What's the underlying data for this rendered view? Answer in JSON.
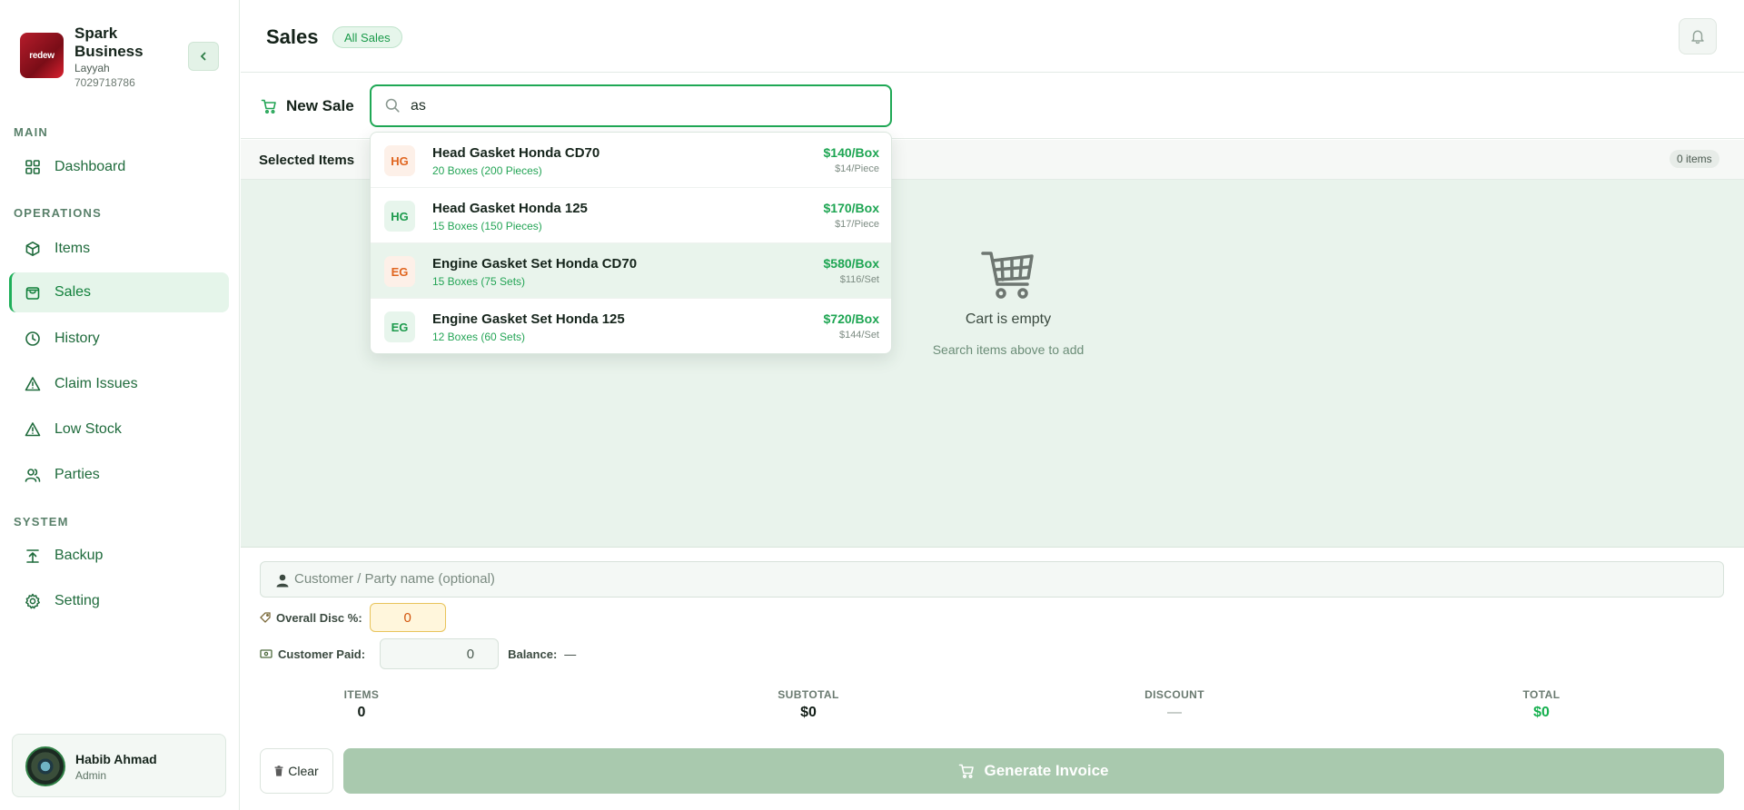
{
  "brand": {
    "logo_text": "redew",
    "name": "Spark Business",
    "location": "Layyah",
    "phone": "7029718786"
  },
  "sidebar": {
    "sections": {
      "main": "MAIN",
      "operations": "OPERATIONS",
      "system": "SYSTEM"
    },
    "items": [
      {
        "label": "Dashboard",
        "icon": "grid-icon"
      },
      {
        "label": "Items",
        "icon": "box-icon"
      },
      {
        "label": "Sales",
        "icon": "bag-icon",
        "active": true
      },
      {
        "label": "History",
        "icon": "clock-icon"
      },
      {
        "label": "Claim Issues",
        "icon": "warning-icon"
      },
      {
        "label": "Low Stock",
        "icon": "warning-icon"
      },
      {
        "label": "Parties",
        "icon": "users-icon"
      },
      {
        "label": "Backup",
        "icon": "backup-icon"
      },
      {
        "label": "Setting",
        "icon": "gear-icon"
      }
    ]
  },
  "user": {
    "name": "Habib Ahmad",
    "role": "Admin"
  },
  "header": {
    "title": "Sales",
    "pill": "All Sales"
  },
  "new_sale": {
    "label": "New Sale",
    "search_value": "as"
  },
  "cart": {
    "title": "Selected Items",
    "count": "0 items",
    "empty_title": "Cart is empty",
    "empty_sub": "Search items above to add"
  },
  "search_results": [
    {
      "badge": "HG",
      "name": "Head Gasket Honda CD70",
      "stock": "20 Boxes (200 Pieces)",
      "price": "$140/Box",
      "unit_price": "$14/Piece",
      "badge_color": "#e0651f"
    },
    {
      "badge": "HG",
      "name": "Head Gasket Honda 125",
      "stock": "15 Boxes (150 Pieces)",
      "price": "$170/Box",
      "unit_price": "$17/Piece",
      "badge_color": "#1c9a4c"
    },
    {
      "badge": "EG",
      "name": "Engine Gasket Set Honda CD70",
      "stock": "15 Boxes (75 Sets)",
      "price": "$580/Box",
      "unit_price": "$116/Set",
      "badge_color": "#e0651f"
    },
    {
      "badge": "EG",
      "name": "Engine Gasket Set Honda 125",
      "stock": "12 Boxes (60 Sets)",
      "price": "$720/Box",
      "unit_price": "$144/Set",
      "badge_color": "#1c9a4c"
    }
  ],
  "checkout": {
    "customer_placeholder": "Customer / Party name (optional)",
    "disc_label": "Overall Disc %:",
    "disc_value": "0",
    "paid_label": "Customer Paid:",
    "paid_value": "0",
    "balance_label": "Balance:",
    "balance_value": "—"
  },
  "summary": {
    "items_label": "ITEMS",
    "items_value": "0",
    "subtotal_label": "SUBTOTAL",
    "subtotal_value": "$0",
    "discount_label": "DISCOUNT",
    "discount_value": "—",
    "total_label": "TOTAL",
    "total_value": "$0"
  },
  "actions": {
    "clear": "Clear",
    "generate": "Generate Invoice"
  },
  "colors": {
    "accent": "#1eaf59",
    "accent_light": "#e5f5ea",
    "orange_badge": "#e0651f"
  }
}
